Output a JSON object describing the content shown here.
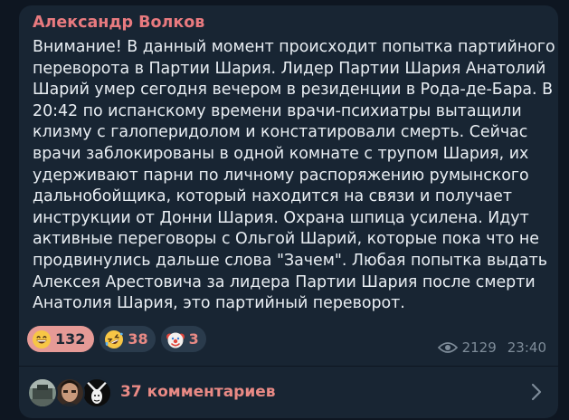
{
  "message": {
    "author": "Александр Волков",
    "lines": [
      "Внимание! В данный момент происходит попытка партийного",
      "переворота в Партии Шария. Лидер Партии Шария Анатолий",
      "Шарий умер сегодня вечером в резиденции в Рода-де-Бара. В",
      "20:42 по испанскому времени врачи-психиатры вытащили",
      "клизму с галоперидолом и констатировали смерть. Сейчас",
      "врачи заблокированы в одной комнате с трупом Шария, их",
      "удерживают парни по личному распоряжению румынского",
      "дальнобойщика, который находится на связи и получает",
      "инструкции от Донни Шария. Охрана шпица усилена. Идут",
      "активные переговоры с Ольгой Шарий, которые пока что не",
      "продвинулись дальше слова \"Зачем\". Любая попытка выдать",
      "Алексея Арестовича за лидера Партии Шария после смерти",
      "Анатолия Шария, это партийный переворот."
    ]
  },
  "reactions": [
    {
      "icon": "grinning-face-icon",
      "count": "132",
      "selected": true
    },
    {
      "icon": "rolling-laughing-face-icon",
      "count": "38",
      "selected": false
    },
    {
      "icon": "clown-face-icon",
      "count": "3",
      "selected": false
    }
  ],
  "meta": {
    "views": "2129",
    "time": "23:40",
    "views_icon": "eye-icon"
  },
  "comments": {
    "label": "37 комментариев",
    "avatar_count": 3,
    "chevron_icon": "chevron-right-icon"
  },
  "colors": {
    "background": "#0e1621",
    "bubble": "#182533",
    "author": "#e87a7f",
    "accent": "#e98a85",
    "selected_reaction": "#e59a96",
    "text": "#e9eef3",
    "meta": "#7e8c99"
  }
}
